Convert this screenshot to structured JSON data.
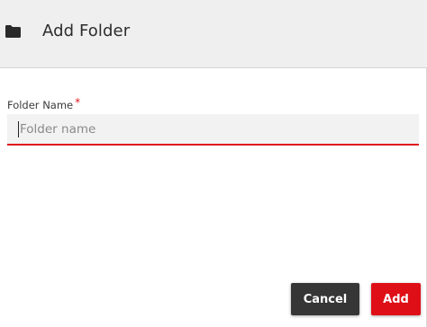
{
  "dialog": {
    "title": "Add Folder",
    "header_icon": "folder-icon"
  },
  "form": {
    "folder_name_label": "Folder Name",
    "required_marker": "*",
    "folder_name_placeholder": "Folder name",
    "folder_name_value": ""
  },
  "actions": {
    "cancel_label": "Cancel",
    "add_label": "Add"
  },
  "colors": {
    "accent": "#df0f17",
    "cancel_button": "#363636",
    "header_background": "#efefef",
    "input_background": "#f2f2f2"
  }
}
